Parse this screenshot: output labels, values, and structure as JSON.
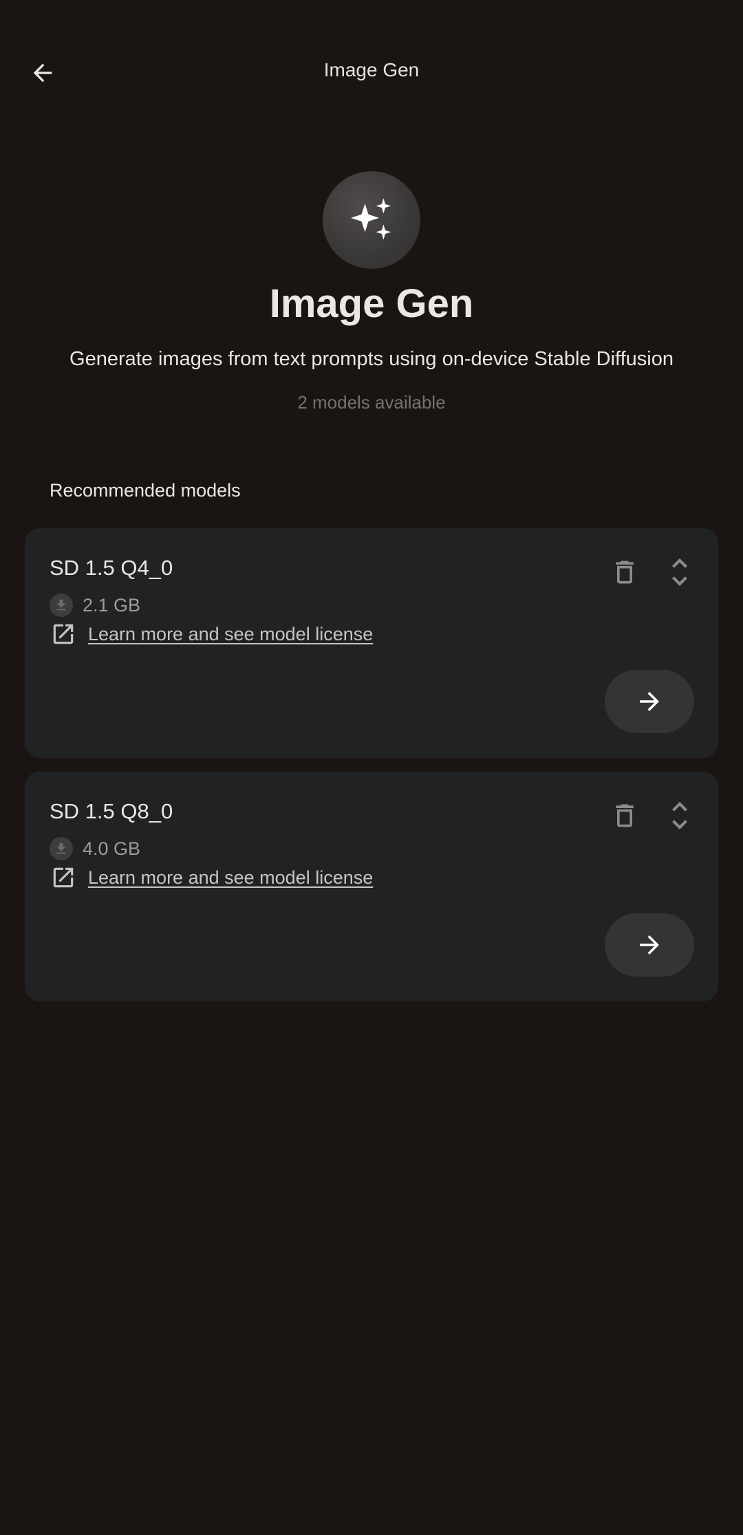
{
  "header": {
    "title": "Image Gen",
    "back_icon": "arrow-back-icon"
  },
  "hero": {
    "icon": "sparkles-icon",
    "title": "Image Gen",
    "subtitle": "Generate images from text prompts using on-device Stable Diffusion",
    "count": "2 models available"
  },
  "section": {
    "label": "Recommended models"
  },
  "models": [
    {
      "name": "SD 1.5 Q4_0",
      "size": "2.1 GB",
      "link": "Learn more and see model license"
    },
    {
      "name": "SD 1.5 Q8_0",
      "size": "4.0 GB",
      "link": "Learn more and see model license"
    }
  ],
  "colors": {
    "background": "#1a1513",
    "card": "#212224",
    "button": "#333436",
    "text": "#ece7e5",
    "muted": "#77716e"
  }
}
